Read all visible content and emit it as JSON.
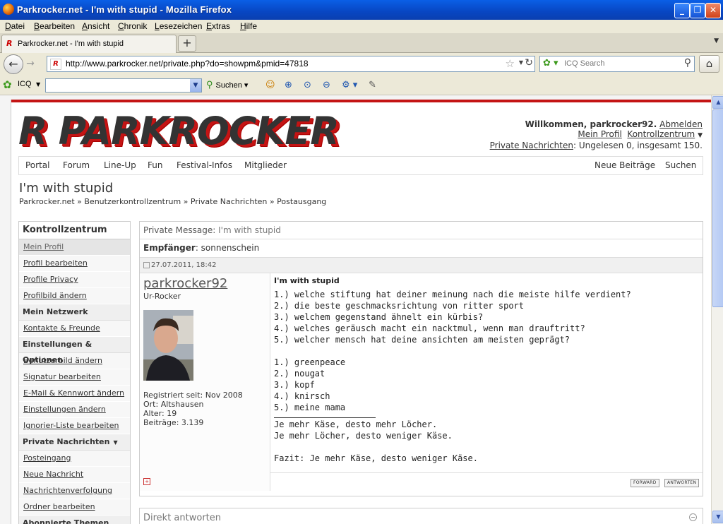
{
  "window": {
    "title": "Parkrocker.net - I'm with stupid",
    "title_suffix": " - Mozilla Firefox"
  },
  "menu": [
    "Datei",
    "Bearbeiten",
    "Ansicht",
    "Chronik",
    "Lesezeichen",
    "Extras",
    "Hilfe"
  ],
  "tab": {
    "label": "Parkrocker.net - I'm with stupid",
    "new_tab": "+"
  },
  "navigation": {
    "url": "http://www.parkrocker.net/private.php?do=showpm&pmid=47818",
    "search_placeholder": "ICQ Search"
  },
  "icq_toolbar": {
    "label": "ICQ",
    "search_label": "Suchen"
  },
  "site": {
    "logo": {
      "r": "R",
      "name": "PARKROCKER"
    },
    "welcome": {
      "greeting": "Willkommen, parkrocker92.",
      "logout": "Abmelden",
      "profile": "Mein Profil",
      "control": "Kontrollzentrum",
      "pm_link": "Private Nachrichten",
      "pm_status": ": Ungelesen 0, insgesamt 150."
    },
    "nav": {
      "left": [
        "Portal",
        "Forum",
        "Line-Up",
        "Fun",
        "Festival-Infos",
        "Mitglieder"
      ],
      "right": [
        "Neue Beiträge",
        "Suchen"
      ]
    },
    "page_title": "I'm with stupid",
    "breadcrumb": [
      "Parkrocker.net",
      "Benutzerkontrollzentrum",
      "Private Nachrichten",
      "Postausgang"
    ]
  },
  "sidebar": {
    "title": "Kontrollzentrum",
    "items": [
      {
        "type": "item",
        "label": "Mein Profil",
        "current": true
      },
      {
        "type": "item",
        "label": "Profil bearbeiten"
      },
      {
        "type": "item",
        "label": "Profile Privacy"
      },
      {
        "type": "item",
        "label": "Profilbild ändern"
      },
      {
        "type": "group",
        "label": "Mein Netzwerk"
      },
      {
        "type": "item",
        "label": "Kontakte & Freunde"
      },
      {
        "type": "group",
        "label": "Einstellungen & Optionen"
      },
      {
        "type": "item",
        "label": "Benutzerbild ändern"
      },
      {
        "type": "item",
        "label": "Signatur bearbeiten"
      },
      {
        "type": "item",
        "label": "E-Mail & Kennwort ändern"
      },
      {
        "type": "item",
        "label": "Einstellungen ändern"
      },
      {
        "type": "item",
        "label": "Ignorier-Liste bearbeiten"
      },
      {
        "type": "group",
        "label": "Private Nachrichten",
        "caret": true
      },
      {
        "type": "item",
        "label": "Posteingang"
      },
      {
        "type": "item",
        "label": "Neue Nachricht"
      },
      {
        "type": "item",
        "label": "Nachrichtenverfolgung"
      },
      {
        "type": "item",
        "label": "Ordner bearbeiten"
      },
      {
        "type": "group",
        "label": "Abonnierte Themen"
      }
    ]
  },
  "pm": {
    "header_key": "Private Message:",
    "header_value": "I'm with stupid",
    "recipient_key": "Empfänger",
    "recipient": "sonnenschein",
    "date": "27.07.2011, 18:42",
    "author": "parkrocker92",
    "user_title": "Ur-Rocker",
    "user_info": [
      "Registriert seit: Nov 2008",
      "Ort: Altshausen",
      "Alter: 19",
      "Beiträge: 3.139"
    ],
    "subject": "I'm with stupid",
    "questions": [
      "1.) welche stiftung hat deiner meinung nach die meiste hilfe verdient?",
      "2.) die beste geschmacksrichtung von ritter sport",
      "3.) welchem gegenstand ähnelt ein kürbis?",
      "4.) welches geräusch macht ein nacktmul, wenn man drauftritt?",
      "5.) welcher mensch hat deine ansichten am meisten geprägt?"
    ],
    "answers": [
      "1.) greenpeace",
      "2.) nougat",
      "3.) kopf",
      "4.) knirsch",
      "5.) meine mama"
    ],
    "signature": [
      "Je mehr Käse, desto mehr Löcher.",
      "Je mehr Löcher, desto weniger Käse.",
      "",
      "Fazit: Je mehr Käse, desto weniger Käse."
    ],
    "buttons": {
      "forward": "FORWARD",
      "reply": "ANTWORTEN"
    }
  },
  "quick_reply": {
    "label": "Direkt antworten"
  },
  "colors": {
    "accent_red": "#c41414",
    "titlebar_blue": "#0846c2"
  }
}
